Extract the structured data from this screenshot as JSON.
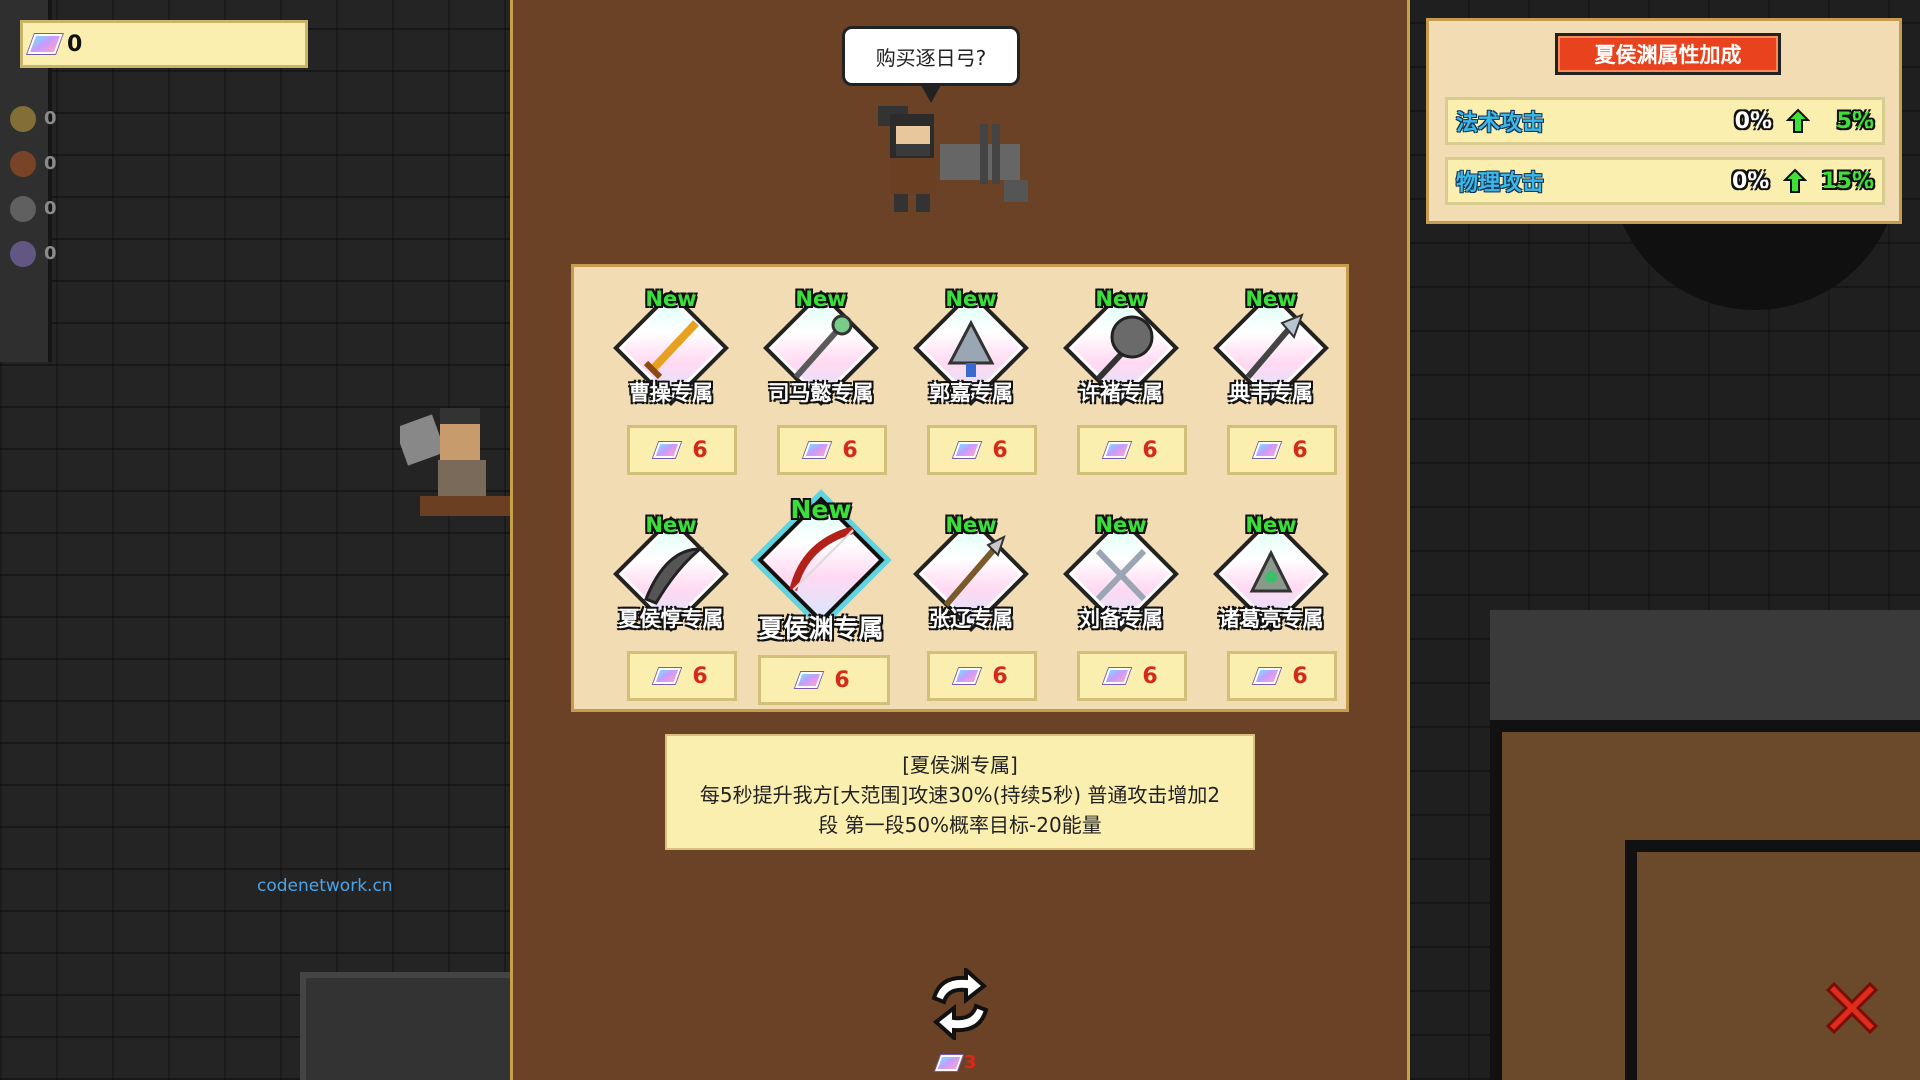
{
  "currency": {
    "amount": "0"
  },
  "resources": [
    {
      "icon": "gold-ingot-icon",
      "value": "0",
      "color": "#c9a23a"
    },
    {
      "icon": "coin-icon",
      "value": "0",
      "color": "#b4541f"
    },
    {
      "icon": "stone-icon",
      "value": "0",
      "color": "#888888"
    },
    {
      "icon": "crystal-icon",
      "value": "0",
      "color": "#8c78c8"
    }
  ],
  "watermark": "codenetwork.cn",
  "merchant": {
    "speech": "购买逐日弓?"
  },
  "shop": {
    "items": [
      {
        "new": "New",
        "name": "曹操专属",
        "price": "6",
        "weapon": "sword-icon"
      },
      {
        "new": "New",
        "name": "司马懿专属",
        "price": "6",
        "weapon": "staff-icon"
      },
      {
        "new": "New",
        "name": "郭嘉专属",
        "price": "6",
        "weapon": "fan-icon"
      },
      {
        "new": "New",
        "name": "许褚专属",
        "price": "6",
        "weapon": "mace-icon"
      },
      {
        "new": "New",
        "name": "典韦专属",
        "price": "6",
        "weapon": "halberd-icon"
      },
      {
        "new": "New",
        "name": "夏侯惇专属",
        "price": "6",
        "weapon": "scimitar-icon"
      },
      {
        "new": "New",
        "name": "夏侯渊专属",
        "price": "6",
        "weapon": "bow-icon",
        "selected": true
      },
      {
        "new": "New",
        "name": "张辽专属",
        "price": "6",
        "weapon": "spear-icon"
      },
      {
        "new": "New",
        "name": "刘备专属",
        "price": "6",
        "weapon": "twin-swords-icon"
      },
      {
        "new": "New",
        "name": "诸葛亮专属",
        "price": "6",
        "weapon": "feather-fan-icon"
      }
    ],
    "description": {
      "title": "[夏侯渊专属]",
      "line1": "每5秒提升我方[大范围]攻速30%(持续5秒) 普通攻击增加2",
      "line2": "段 第一段50%概率目标-20能量"
    },
    "refresh_cost": "3"
  },
  "bonus_panel": {
    "title": "夏侯渊属性加成",
    "stats": [
      {
        "name": "法术攻击",
        "current": "0%",
        "new": "5%"
      },
      {
        "name": "物理攻击",
        "current": "0%",
        "new": "15%"
      }
    ]
  },
  "colors": {
    "panel_bg": "#6b4226",
    "new_green": "#39e03a",
    "price_red": "#d52a1a",
    "title_red": "#e8431e",
    "stat_blue": "#3cb8e8"
  }
}
